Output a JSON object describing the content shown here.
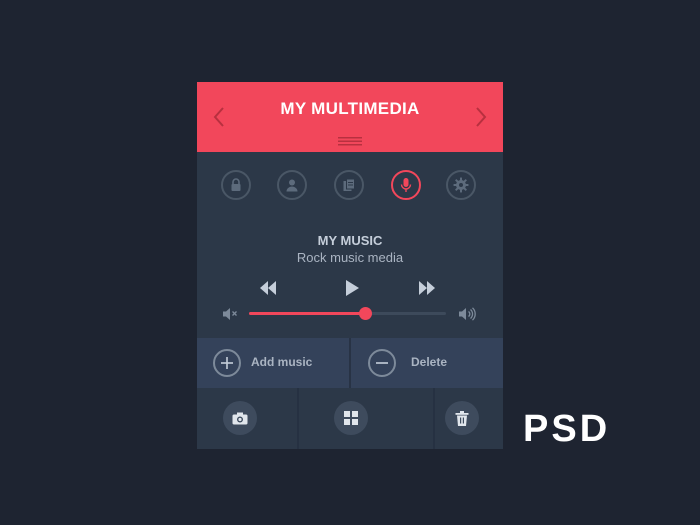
{
  "header": {
    "title": "MY MULTIMEDIA",
    "prev_icon": "chevron-left-icon",
    "next_icon": "chevron-right-icon",
    "menu_icon": "menu-lines-icon",
    "color": "#f2475b"
  },
  "toolbar": {
    "icons": [
      "lock-icon",
      "user-icon",
      "document-icon",
      "microphone-icon",
      "gear-icon"
    ],
    "active_icon": "microphone-icon"
  },
  "player": {
    "title": "MY MUSIC",
    "subtitle": "Rock music media",
    "volume_percent": 59,
    "controls": [
      "rewind-icon",
      "play-icon",
      "fast-forward-icon"
    ],
    "mute_icon": "volume-mute-icon",
    "loud_icon": "volume-up-icon"
  },
  "actions": {
    "add_label": "Add music",
    "delete_label": "Delete"
  },
  "bottom": {
    "buttons": [
      "camera-icon",
      "grid-icon",
      "trash-icon"
    ]
  },
  "badge": "PSD",
  "colors": {
    "background": "#1e2431",
    "panel": "#2c3848",
    "accent": "#f2475b"
  }
}
